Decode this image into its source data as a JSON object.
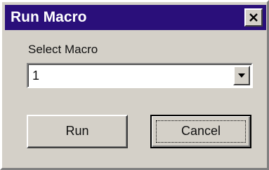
{
  "window": {
    "title": "Run Macro",
    "title_bar_color": "#2a0f7a",
    "close_icon": "close-icon"
  },
  "form": {
    "select_label": "Select Macro",
    "select_value": "1",
    "dropdown_icon": "chevron-down-icon"
  },
  "buttons": {
    "run_label": "Run",
    "cancel_label": "Cancel"
  }
}
